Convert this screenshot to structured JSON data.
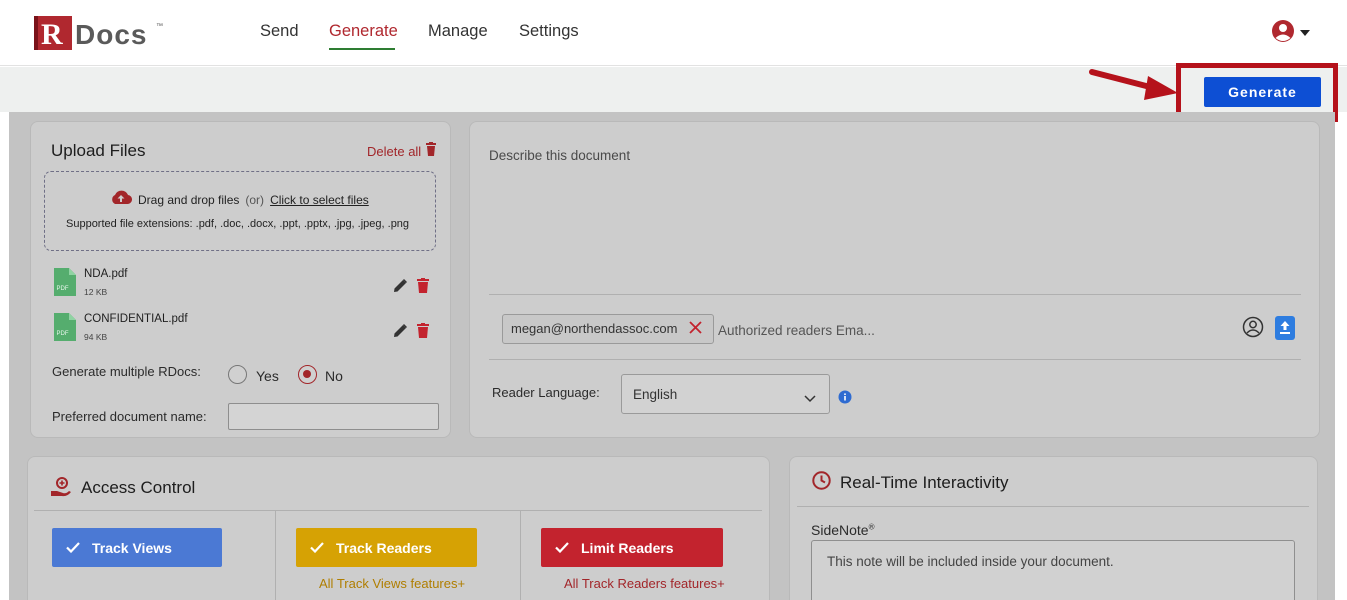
{
  "brand": {
    "logo_r": "R",
    "logo_text": "Docs",
    "trademark": "™"
  },
  "nav": {
    "items": [
      "Send",
      "Generate",
      "Manage",
      "Settings"
    ],
    "active": "Generate"
  },
  "toolbar": {
    "generate_label": "Generate"
  },
  "upload": {
    "title": "Upload Files",
    "delete_all": "Delete all",
    "drop_text": "Drag and drop files",
    "or_text": "(or)",
    "select_link": "Click to select files",
    "extensions": "Supported file extensions: .pdf, .doc, .docx, .ppt, .pptx, .jpg, .jpeg, .png",
    "files": [
      {
        "name": "NDA.pdf",
        "size": "12 KB",
        "type": "PDF"
      },
      {
        "name": "CONFIDENTIAL.pdf",
        "size": "94 KB",
        "type": "PDF"
      }
    ],
    "multiple_label": "Generate multiple RDocs:",
    "yes": "Yes",
    "no": "No",
    "multiple_selected": "No",
    "doc_name_label": "Preferred document name:",
    "doc_name_value": ""
  },
  "description": {
    "placeholder": "Describe this document",
    "email_chip": "megan@northendassoc.com",
    "readers_placeholder": "Authorized readers Ema...",
    "language_label": "Reader Language:",
    "language_value": "English"
  },
  "access": {
    "title": "Access Control",
    "track_views": "Track Views",
    "track_readers": "Track Readers",
    "track_readers_sub": "All Track Views features+",
    "limit_readers": "Limit Readers",
    "limit_readers_sub": "All Track Readers features+"
  },
  "interactivity": {
    "title": "Real-Time Interactivity",
    "sidenote_label": "SideNote",
    "sidenote_mark": "®",
    "sidenote_placeholder": "This note will be included inside your document."
  },
  "colors": {
    "brand_red": "#b0282f",
    "primary_blue": "#0d4fd4",
    "track_views": "#4b79d4",
    "track_readers": "#d6a204",
    "limit_readers": "#c3232e",
    "highlight": "#b5121b"
  }
}
